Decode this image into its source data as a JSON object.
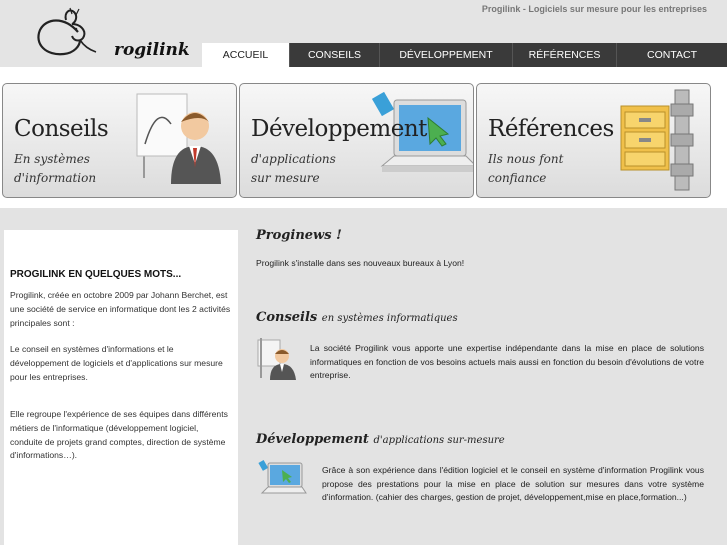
{
  "header": {
    "logo_text": "rogilink",
    "tagline": "Progilink - Logiciels sur mesure pour les entreprises"
  },
  "nav": [
    {
      "label": "ACCUEIL"
    },
    {
      "label": "CONSEILS"
    },
    {
      "label": "DÉVELOPPEMENT"
    },
    {
      "label": "RÉFÉRENCES"
    },
    {
      "label": "CONTACT"
    }
  ],
  "banners": [
    {
      "title": "Conseils",
      "line1": "En systèmes",
      "line2": "d'information",
      "icon": "consultant-icon"
    },
    {
      "title": "Développement",
      "line1": "d'applications",
      "line2": "sur mesure",
      "icon": "laptop-icon"
    },
    {
      "title": "Références",
      "line1": "Ils nous font",
      "line2": "confiance",
      "icon": "file-archive-icon"
    }
  ],
  "sidebar": {
    "title": "PROGILINK EN QUELQUES MOTS...",
    "p1": "Progilink, créée en octobre 2009 par Johann Berchet, est une société de service en informatique dont les 2 activités principales sont :",
    "p2": "Le conseil en systèmes d'informations et le développement de logiciels et d'applications sur mesure pour les entreprises.",
    "p3": "Elle regroupe l'expérience de ses équipes dans différents métiers de l'informatique (développement logiciel, conduite de projets grand comptes, direction de système d'informations…)."
  },
  "main": {
    "news_title": "Proginews !",
    "news_text": "Progilink s'installe dans ses nouveaux bureaux à Lyon!",
    "conseils_title": "Conseils",
    "conseils_sub": "en systèmes informatiques",
    "conseils_text": "La société Progilink vous apporte une expertise indépendante dans la mise en place de solutions informatiques en fonction de vos besoins actuels mais aussi en fonction du besoin d'évolutions de votre entreprise.",
    "dev_title": "Développement",
    "dev_sub": "d'applications sur-mesure",
    "dev_text": "Grâce à son expérience dans l'édition logiciel et le conseil en système d'information Progilink vous propose des prestations pour la mise en place de solution sur mesures dans votre système d'information. (cahier des charges, gestion de projet, développement,mise en place,formation...)"
  }
}
